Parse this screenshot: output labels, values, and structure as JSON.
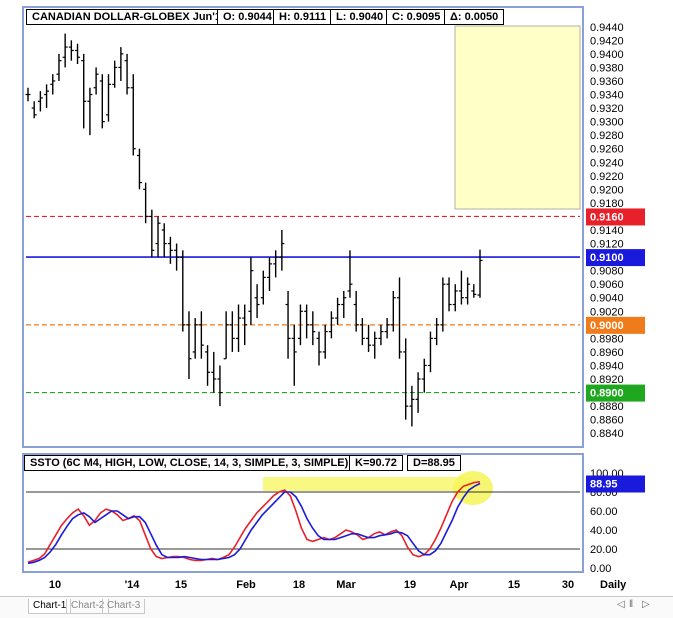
{
  "header": {
    "fields": [
      "CANADIAN DOLLAR-GLOBEX Jun'14",
      "O: 0.9044",
      "H: 0.9111",
      "L: 0.9040",
      "C: 0.9095",
      "Δ: 0.0050"
    ]
  },
  "stoch_header": {
    "fields": [
      "SSTO (6C M4, HIGH, LOW, CLOSE, 14, 3, SIMPLE, 3, SIMPLE)",
      "K=90.72",
      "D=88.95"
    ]
  },
  "price_axis_labels": [
    "0.9440",
    "0.9420",
    "0.9400",
    "0.9380",
    "0.9360",
    "0.9340",
    "0.9320",
    "0.9300",
    "0.9280",
    "0.9260",
    "0.9240",
    "0.9220",
    "0.9200",
    "0.9180",
    "0.9140",
    "0.9120",
    "0.9080",
    "0.9060",
    "0.9040",
    "0.9020",
    "0.8980",
    "0.8960",
    "0.8940",
    "0.8920",
    "0.8880",
    "0.8860",
    "0.8840"
  ],
  "stoch_axis_labels": [
    "100.00",
    "80.00",
    "60.00",
    "40.00",
    "20.00",
    "0.00"
  ],
  "x_axis_labels": [
    "10",
    "'14",
    "15",
    "Feb",
    "18",
    "Mar",
    "19",
    "Apr",
    "15",
    "30",
    "Daily"
  ],
  "levels": [
    {
      "value": 0.916,
      "label": "0.9160",
      "color": "#e8202a",
      "style": "dashed"
    },
    {
      "value": 0.91,
      "label": "0.9100",
      "color": "#1a1adc",
      "style": "solid"
    },
    {
      "value": 0.9,
      "label": "0.9000",
      "color": "#f07b1a",
      "style": "dashed"
    },
    {
      "value": 0.89,
      "label": "0.8900",
      "color": "#1fa81f",
      "style": "dashed"
    }
  ],
  "stoch_current_label": "88.95",
  "tabs": [
    "Chart-1",
    "Chart-2",
    "Chart-3"
  ],
  "nav_icons": [
    "prev-icon",
    "pause-icon",
    "next-icon"
  ],
  "colors": {
    "frame": "#8aa0d8",
    "bars": "#000000",
    "k_line": "#e8202a",
    "d_line": "#1a1adc",
    "highlight": "#f5f55a",
    "note_box": "#ffffc8"
  },
  "chart_data": [
    {
      "type": "ohlc",
      "title": "CANADIAN DOLLAR-GLOBEX Jun'14",
      "ylim": [
        0.883,
        0.945
      ],
      "bars": [
        {
          "o": 0.934,
          "h": 0.935,
          "l": 0.933,
          "c": 0.934
        },
        {
          "o": 0.932,
          "h": 0.933,
          "l": 0.9305,
          "c": 0.931
        },
        {
          "o": 0.933,
          "h": 0.9345,
          "l": 0.9315,
          "c": 0.9335
        },
        {
          "o": 0.934,
          "h": 0.9355,
          "l": 0.932,
          "c": 0.9345
        },
        {
          "o": 0.9355,
          "h": 0.937,
          "l": 0.934,
          "c": 0.936
        },
        {
          "o": 0.937,
          "h": 0.94,
          "l": 0.936,
          "c": 0.939
        },
        {
          "o": 0.9395,
          "h": 0.943,
          "l": 0.938,
          "c": 0.941
        },
        {
          "o": 0.941,
          "h": 0.942,
          "l": 0.939,
          "c": 0.9405
        },
        {
          "o": 0.9405,
          "h": 0.9415,
          "l": 0.9385,
          "c": 0.9395
        },
        {
          "o": 0.939,
          "h": 0.94,
          "l": 0.929,
          "c": 0.933
        },
        {
          "o": 0.933,
          "h": 0.935,
          "l": 0.928,
          "c": 0.934
        },
        {
          "o": 0.935,
          "h": 0.938,
          "l": 0.934,
          "c": 0.937
        },
        {
          "o": 0.936,
          "h": 0.937,
          "l": 0.929,
          "c": 0.93
        },
        {
          "o": 0.931,
          "h": 0.937,
          "l": 0.93,
          "c": 0.9355
        },
        {
          "o": 0.9355,
          "h": 0.939,
          "l": 0.935,
          "c": 0.938
        },
        {
          "o": 0.938,
          "h": 0.941,
          "l": 0.936,
          "c": 0.94
        },
        {
          "o": 0.939,
          "h": 0.94,
          "l": 0.934,
          "c": 0.935
        },
        {
          "o": 0.935,
          "h": 0.937,
          "l": 0.925,
          "c": 0.926
        },
        {
          "o": 0.925,
          "h": 0.926,
          "l": 0.92,
          "c": 0.921
        },
        {
          "o": 0.92,
          "h": 0.921,
          "l": 0.915,
          "c": 0.916
        },
        {
          "o": 0.916,
          "h": 0.917,
          "l": 0.91,
          "c": 0.911
        },
        {
          "o": 0.912,
          "h": 0.916,
          "l": 0.91,
          "c": 0.915
        },
        {
          "o": 0.914,
          "h": 0.915,
          "l": 0.91,
          "c": 0.912
        },
        {
          "o": 0.912,
          "h": 0.913,
          "l": 0.909,
          "c": 0.911
        },
        {
          "o": 0.911,
          "h": 0.912,
          "l": 0.908,
          "c": 0.91
        },
        {
          "o": 0.91,
          "h": 0.911,
          "l": 0.899,
          "c": 0.9
        },
        {
          "o": 0.9,
          "h": 0.902,
          "l": 0.892,
          "c": 0.895
        },
        {
          "o": 0.896,
          "h": 0.901,
          "l": 0.895,
          "c": 0.9
        },
        {
          "o": 0.9,
          "h": 0.902,
          "l": 0.895,
          "c": 0.897
        },
        {
          "o": 0.896,
          "h": 0.897,
          "l": 0.891,
          "c": 0.893
        },
        {
          "o": 0.893,
          "h": 0.896,
          "l": 0.89,
          "c": 0.892
        },
        {
          "o": 0.892,
          "h": 0.894,
          "l": 0.888,
          "c": 0.89
        },
        {
          "o": 0.895,
          "h": 0.902,
          "l": 0.895,
          "c": 0.9
        },
        {
          "o": 0.9,
          "h": 0.902,
          "l": 0.896,
          "c": 0.898
        },
        {
          "o": 0.898,
          "h": 0.903,
          "l": 0.896,
          "c": 0.901
        },
        {
          "o": 0.901,
          "h": 0.903,
          "l": 0.897,
          "c": 0.9
        },
        {
          "o": 0.902,
          "h": 0.91,
          "l": 0.9,
          "c": 0.908
        },
        {
          "o": 0.904,
          "h": 0.906,
          "l": 0.901,
          "c": 0.903
        },
        {
          "o": 0.904,
          "h": 0.908,
          "l": 0.903,
          "c": 0.907
        },
        {
          "o": 0.907,
          "h": 0.91,
          "l": 0.905,
          "c": 0.909
        },
        {
          "o": 0.909,
          "h": 0.911,
          "l": 0.907,
          "c": 0.91
        },
        {
          "o": 0.91,
          "h": 0.914,
          "l": 0.908,
          "c": 0.912
        },
        {
          "o": 0.903,
          "h": 0.905,
          "l": 0.895,
          "c": 0.898
        },
        {
          "o": 0.898,
          "h": 0.9,
          "l": 0.891,
          "c": 0.896
        },
        {
          "o": 0.898,
          "h": 0.903,
          "l": 0.897,
          "c": 0.902
        },
        {
          "o": 0.902,
          "h": 0.903,
          "l": 0.898,
          "c": 0.9
        },
        {
          "o": 0.9,
          "h": 0.902,
          "l": 0.897,
          "c": 0.899
        },
        {
          "o": 0.898,
          "h": 0.899,
          "l": 0.894,
          "c": 0.896
        },
        {
          "o": 0.896,
          "h": 0.9,
          "l": 0.895,
          "c": 0.899
        },
        {
          "o": 0.899,
          "h": 0.902,
          "l": 0.898,
          "c": 0.901
        },
        {
          "o": 0.901,
          "h": 0.904,
          "l": 0.9,
          "c": 0.903
        },
        {
          "o": 0.903,
          "h": 0.905,
          "l": 0.901,
          "c": 0.904
        },
        {
          "o": 0.905,
          "h": 0.911,
          "l": 0.904,
          "c": 0.906
        },
        {
          "o": 0.903,
          "h": 0.905,
          "l": 0.899,
          "c": 0.9
        },
        {
          "o": 0.9,
          "h": 0.901,
          "l": 0.897,
          "c": 0.898
        },
        {
          "o": 0.898,
          "h": 0.9,
          "l": 0.896,
          "c": 0.897
        },
        {
          "o": 0.897,
          "h": 0.899,
          "l": 0.895,
          "c": 0.898
        },
        {
          "o": 0.898,
          "h": 0.9,
          "l": 0.897,
          "c": 0.899
        },
        {
          "o": 0.899,
          "h": 0.901,
          "l": 0.898,
          "c": 0.9
        },
        {
          "o": 0.9,
          "h": 0.905,
          "l": 0.899,
          "c": 0.904
        },
        {
          "o": 0.904,
          "h": 0.907,
          "l": 0.895,
          "c": 0.896
        },
        {
          "o": 0.896,
          "h": 0.898,
          "l": 0.886,
          "c": 0.888
        },
        {
          "o": 0.888,
          "h": 0.891,
          "l": 0.885,
          "c": 0.889
        },
        {
          "o": 0.889,
          "h": 0.893,
          "l": 0.887,
          "c": 0.892
        },
        {
          "o": 0.892,
          "h": 0.895,
          "l": 0.89,
          "c": 0.894
        },
        {
          "o": 0.894,
          "h": 0.899,
          "l": 0.893,
          "c": 0.898
        },
        {
          "o": 0.898,
          "h": 0.901,
          "l": 0.897,
          "c": 0.9
        },
        {
          "o": 0.9,
          "h": 0.907,
          "l": 0.899,
          "c": 0.906
        },
        {
          "o": 0.906,
          "h": 0.907,
          "l": 0.902,
          "c": 0.903
        },
        {
          "o": 0.903,
          "h": 0.906,
          "l": 0.902,
          "c": 0.905
        },
        {
          "o": 0.905,
          "h": 0.908,
          "l": 0.903,
          "c": 0.904
        },
        {
          "o": 0.904,
          "h": 0.907,
          "l": 0.903,
          "c": 0.906
        },
        {
          "o": 0.905,
          "h": 0.906,
          "l": 0.904,
          "c": 0.9045
        },
        {
          "o": 0.9044,
          "h": 0.9111,
          "l": 0.904,
          "c": 0.9095
        }
      ]
    },
    {
      "type": "line",
      "title": "SSTO (6C M4, HIGH, LOW, CLOSE, 14, 3, SIMPLE, 3, SIMPLE)",
      "ylim": [
        0,
        100
      ],
      "series": [
        {
          "name": "K",
          "values": [
            6,
            8,
            10,
            15,
            25,
            35,
            45,
            52,
            58,
            62,
            55,
            45,
            50,
            58,
            62,
            60,
            56,
            50,
            52,
            55,
            50,
            35,
            20,
            12,
            10,
            11,
            12,
            12,
            11,
            9,
            8,
            8,
            9,
            10,
            9,
            11,
            14,
            22,
            32,
            42,
            50,
            58,
            64,
            70,
            76,
            80,
            82,
            76,
            60,
            42,
            30,
            28,
            30,
            32,
            30,
            32,
            36,
            40,
            38,
            35,
            30,
            32,
            36,
            38,
            35,
            38,
            40,
            34,
            22,
            14,
            12,
            14,
            20,
            30,
            42,
            56,
            70,
            80,
            86,
            88,
            90,
            90.72
          ]
        },
        {
          "name": "D",
          "values": [
            5,
            6,
            8,
            11,
            17,
            25,
            35,
            44,
            52,
            56,
            58,
            54,
            48,
            52,
            56,
            60,
            60,
            56,
            52,
            54,
            54,
            48,
            36,
            24,
            14,
            11,
            11,
            11,
            12,
            11,
            10,
            9,
            9,
            9,
            9,
            10,
            11,
            14,
            20,
            30,
            40,
            48,
            56,
            62,
            68,
            74,
            80,
            80,
            75,
            65,
            52,
            42,
            34,
            30,
            30,
            30,
            32,
            34,
            36,
            36,
            34,
            32,
            32,
            34,
            35,
            36,
            38,
            37,
            34,
            26,
            18,
            14,
            14,
            18,
            26,
            38,
            50,
            64,
            74,
            82,
            86,
            88.95
          ]
        }
      ]
    }
  ]
}
